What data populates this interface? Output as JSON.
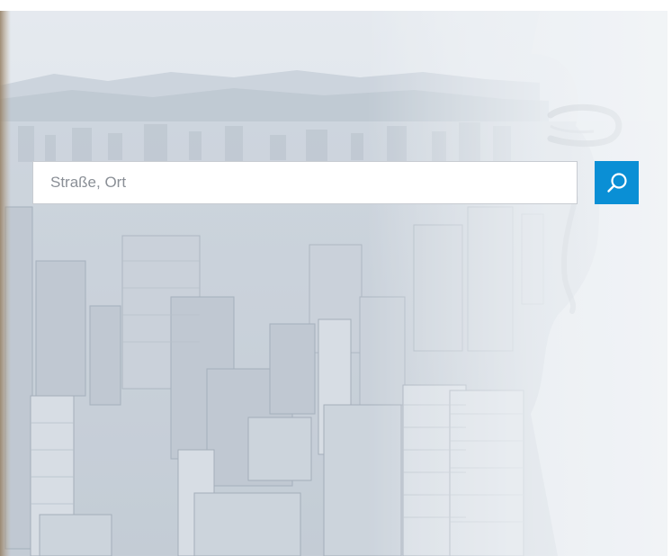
{
  "search": {
    "placeholder": "Straße, Ort",
    "value": ""
  },
  "search_button": {
    "icon": "search-icon"
  },
  "hero": {
    "image": "city-skyline-with-woman-wearing-headphones"
  },
  "colors": {
    "accent": "#0a8fd5",
    "input_border": "#c8ccd2",
    "placeholder": "#8a8f96",
    "photo_tint": "#d9e0e8",
    "left_edge": "#8a6b42"
  }
}
